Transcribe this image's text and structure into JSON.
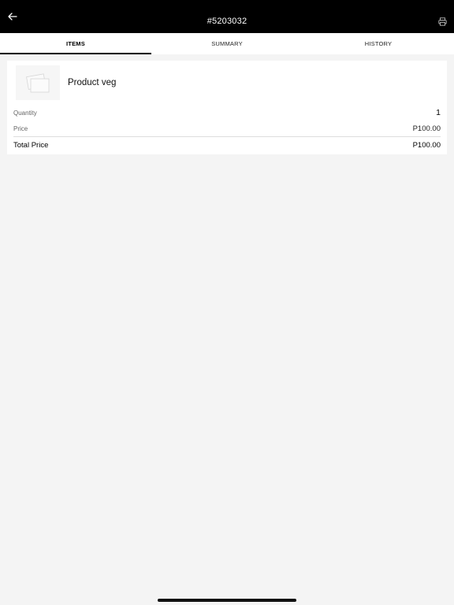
{
  "header": {
    "title": "#5203032",
    "back_icon": "arrow-left-icon",
    "print_icon": "printer-icon"
  },
  "tabs": [
    {
      "label": "ITEMS",
      "active": true
    },
    {
      "label": "SUMMARY",
      "active": false
    },
    {
      "label": "HISTORY",
      "active": false
    }
  ],
  "item": {
    "image_icon": "image-placeholder-icon",
    "name": "Product veg",
    "quantity_label": "Quantity",
    "quantity": "1",
    "price_label": "Price",
    "price": "P100.00",
    "total_label": "Total Price",
    "total": "P100.00"
  },
  "colors": {
    "header_bg": "#000000",
    "page_bg": "#f4f4f4",
    "card_bg": "#ffffff",
    "tab_indicator": "#000000"
  }
}
